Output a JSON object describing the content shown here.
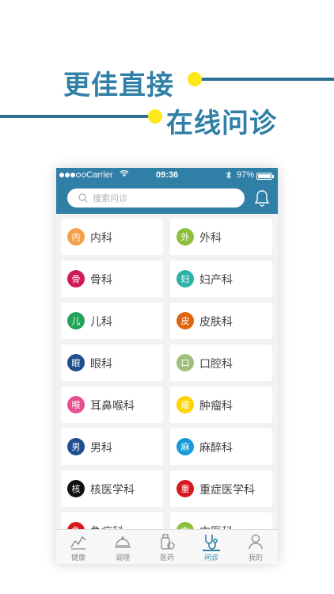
{
  "promo": {
    "headline1": "更佳直接",
    "headline2": "在线问诊"
  },
  "status_bar": {
    "carrier": "Carrier",
    "time": "09:36",
    "battery": "97%",
    "battery_level": 0.97
  },
  "search": {
    "placeholder": "搜索问诊"
  },
  "departments": [
    {
      "badge": "内",
      "label": "内科",
      "color": "#f5a14a"
    },
    {
      "badge": "外",
      "label": "外科",
      "color": "#8dbf3d"
    },
    {
      "badge": "骨",
      "label": "骨科",
      "color": "#d11a5c"
    },
    {
      "badge": "妇",
      "label": "妇产科",
      "color": "#2bb3a8"
    },
    {
      "badge": "儿",
      "label": "儿科",
      "color": "#23a35a"
    },
    {
      "badge": "皮",
      "label": "皮肤科",
      "color": "#e0650f"
    },
    {
      "badge": "眼",
      "label": "眼科",
      "color": "#1f4f8f"
    },
    {
      "badge": "口",
      "label": "口腔科",
      "color": "#9cc07a"
    },
    {
      "badge": "喉",
      "label": "耳鼻喉科",
      "color": "#e8508f"
    },
    {
      "badge": "瘤",
      "label": "肿瘤科",
      "color": "#ffd400"
    },
    {
      "badge": "男",
      "label": "男科",
      "color": "#1f4f8f"
    },
    {
      "badge": "麻",
      "label": "麻醉科",
      "color": "#1a9bd7"
    },
    {
      "badge": "核",
      "label": "核医学科",
      "color": "#111111"
    },
    {
      "badge": "重",
      "label": "重症医学科",
      "color": "#d8181f"
    },
    {
      "badge": "急",
      "label": "急症科",
      "color": "#d8181f"
    },
    {
      "badge": "中",
      "label": "中医科",
      "color": "#8dbf3d"
    }
  ],
  "tabs": [
    {
      "label": "健康",
      "icon": "health-chart-icon",
      "active": false
    },
    {
      "label": "调理",
      "icon": "meal-cover-icon",
      "active": false
    },
    {
      "label": "医药",
      "icon": "medicine-icon",
      "active": false
    },
    {
      "label": "问诊",
      "icon": "stethoscope-icon",
      "active": true
    },
    {
      "label": "我的",
      "icon": "user-icon",
      "active": false
    }
  ],
  "colors": {
    "brand": "#2f7fa6",
    "accent_yellow": "#ffe81a"
  }
}
